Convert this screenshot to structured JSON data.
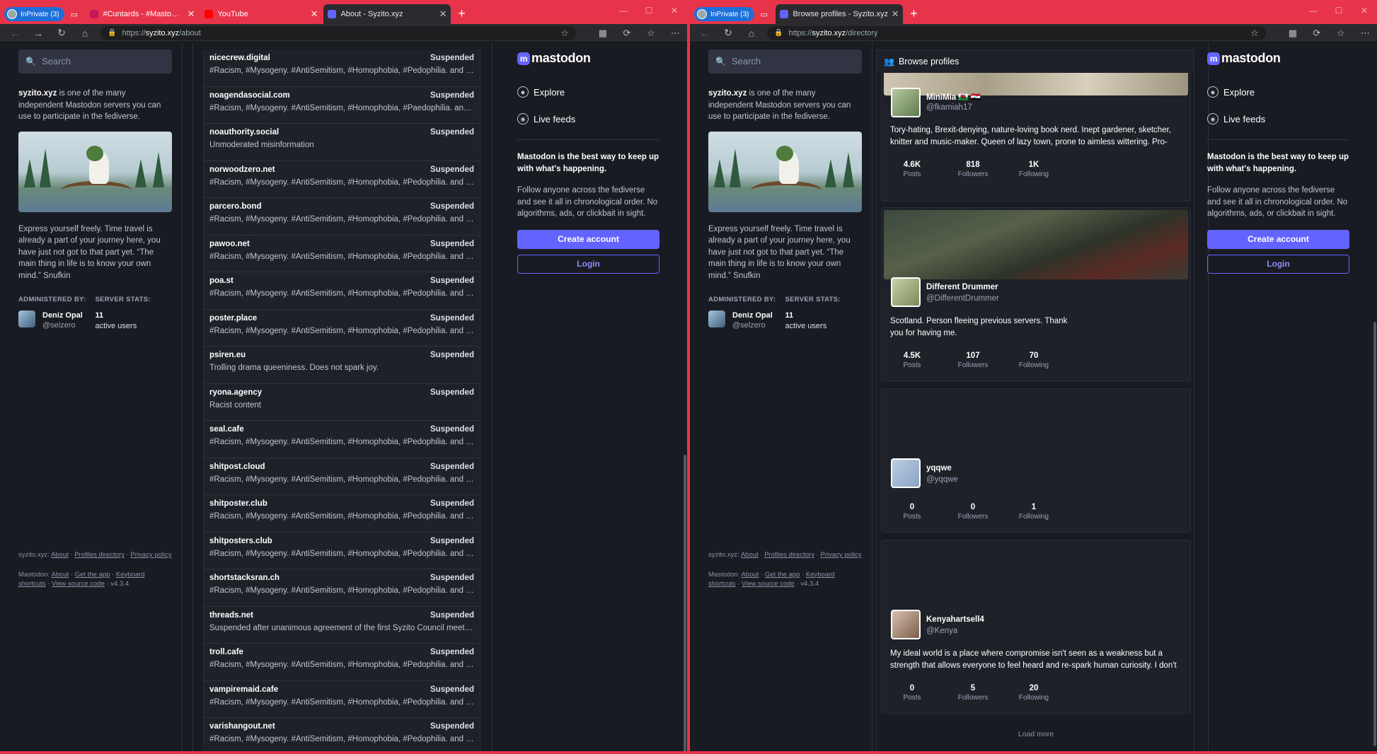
{
  "left_window": {
    "tabs": [
      {
        "label": "InPrivate (3)"
      },
      {
        "label": ""
      },
      {
        "label": "#Cuntards - #MastodonSpyBallo..."
      },
      {
        "label": "YouTube"
      },
      {
        "label": "About - Syzito.xyz"
      }
    ],
    "url_prefix": "https://",
    "url_host": "syzito.xyz",
    "url_path": "/about",
    "search_placeholder": "Search",
    "blocked": [
      {
        "domain": "nicecrew.digital",
        "status": "Suspended",
        "reason": "#Racism, #Mysogeny. #AntiSemitism, #Homophobia, #Pedophilia. and #..."
      },
      {
        "domain": "noagendasocial.com",
        "status": "Suspended",
        "reason": "#Racism, #Mysogeny. #AntiSemitism, #Homophobia, #Paedophilia. and ..."
      },
      {
        "domain": "noauthority.social",
        "status": "Suspended",
        "reason": "Unmoderated misinformation"
      },
      {
        "domain": "norwoodzero.net",
        "status": "Suspended",
        "reason": "#Racism, #Mysogeny. #AntiSemitism, #Homophobia, #Pedophilia. and #..."
      },
      {
        "domain": "parcero.bond",
        "status": "Suspended",
        "reason": "#Racism, #Mysogeny. #AntiSemitism, #Homophobia, #Pedophilia. and #..."
      },
      {
        "domain": "pawoo.net",
        "status": "Suspended",
        "reason": "#Racism, #Mysogeny. #AntiSemitism, #Homophobia, #Pedophilia. and #..."
      },
      {
        "domain": "poa.st",
        "status": "Suspended",
        "reason": "#Racism, #Mysogeny. #AntiSemitism, #Homophobia, #Pedophilia. and #..."
      },
      {
        "domain": "poster.place",
        "status": "Suspended",
        "reason": "#Racism, #Mysogeny. #AntiSemitism, #Homophobia, #Pedophilia. and #..."
      },
      {
        "domain": "psiren.eu",
        "status": "Suspended",
        "reason": "Trolling drama queeniness. Does not spark joy."
      },
      {
        "domain": "ryona.agency",
        "status": "Suspended",
        "reason": "Racist content"
      },
      {
        "domain": "seal.cafe",
        "status": "Suspended",
        "reason": "#Racism, #Mysogeny. #AntiSemitism, #Homophobia, #Pedophilia. and #..."
      },
      {
        "domain": "shitpost.cloud",
        "status": "Suspended",
        "reason": "#Racism, #Mysogeny. #AntiSemitism, #Homophobia, #Pedophilia. and #..."
      },
      {
        "domain": "shitposter.club",
        "status": "Suspended",
        "reason": "#Racism, #Mysogeny. #AntiSemitism, #Homophobia, #Pedophilia. and #..."
      },
      {
        "domain": "shitposters.club",
        "status": "Suspended",
        "reason": "#Racism, #Mysogeny. #AntiSemitism, #Homophobia, #Pedophilia. and #..."
      },
      {
        "domain": "shortstacksran.ch",
        "status": "Suspended",
        "reason": "#Racism, #Mysogeny. #AntiSemitism, #Homophobia, #Pedophilia. and #..."
      },
      {
        "domain": "threads.net",
        "status": "Suspended",
        "reason": "Suspended after unanimous agreement of the first Syzito Council meetin..."
      },
      {
        "domain": "troll.cafe",
        "status": "Suspended",
        "reason": "#Racism, #Mysogeny. #AntiSemitism, #Homophobia, #Pedophilia. and #..."
      },
      {
        "domain": "vampiremaid.cafe",
        "status": "Suspended",
        "reason": "#Racism, #Mysogeny. #AntiSemitism, #Homophobia, #Pedophilia. and #..."
      },
      {
        "domain": "varishangout.net",
        "status": "Suspended",
        "reason": "#Racism, #Mysogeny. #AntiSemitism, #Homophobia, #Pedophilia. and #..."
      }
    ]
  },
  "right_window": {
    "tabs": [
      {
        "label": "InPrivate (3)"
      },
      {
        "label": ""
      },
      {
        "label": "Browse profiles - Syzito.xyz"
      }
    ],
    "url_prefix": "https://",
    "url_host": "syzito.xyz",
    "url_path": "/directory",
    "search_placeholder": "Search",
    "directory_title": "Browse profiles",
    "profiles": [
      {
        "display_name": "MiniMia 🏴󠁧󠁢󠁷󠁬󠁳󠁿 🇮🇶",
        "handle": "@fkamiah17",
        "bio": "Tory-hating, Brexit-denying, nature-loving book nerd. Inept gardener, sketcher, knitter and music-maker. Queen of lazy town, prone to aimless wittering. Pro-",
        "posts": "4.6K",
        "followers": "818",
        "following": "1K"
      },
      {
        "display_name": "Different Drummer",
        "handle": "@DifferentDrummer",
        "bio": "Scotland. Person fleeing previous servers. Thank you for having me.",
        "posts": "4.5K",
        "followers": "107",
        "following": "70"
      },
      {
        "display_name": "yqqwe",
        "handle": "@yqqwe",
        "bio": "",
        "posts": "0",
        "followers": "0",
        "following": "1"
      },
      {
        "display_name": "Kenyahartsell4",
        "handle": "@Kenya",
        "bio": "My ideal world is a place where compromise isn't seen as a weakness but a strength that allows everyone to feel heard and re-spark human curiosity. I don't",
        "posts": "0",
        "followers": "5",
        "following": "20"
      }
    ],
    "stat_labels": {
      "posts": "Posts",
      "followers": "Followers",
      "following": "Following"
    },
    "load_more": "Load more"
  },
  "about": {
    "server": "syzito.xyz",
    "intro_rest": " is one of the many independent Mastodon servers you can use to participate in the fediverse.",
    "description": "Express yourself freely. Time travel is already a part of your journey here, you have just not got to that part yet. “The main thing in life is to know your own mind.” Snufkin",
    "administered_by_label": "Administered by:",
    "server_stats_label": "Server stats:",
    "admin_name": "Deniz Opal",
    "admin_handle": "@selzero",
    "active_users": "11",
    "active_users_label": "active users"
  },
  "footer": {
    "line1_prefix": "syzito.xyz:",
    "about": "About",
    "profiles_directory": "Profiles directory",
    "privacy_policy": "Privacy policy",
    "line2_prefix": "Mastodon:",
    "get_the_app": "Get the app",
    "keyboard_shortcuts": "Keyboard shortcuts",
    "view_source_code": "View source code",
    "version": "v4.3.4"
  },
  "navigation": {
    "logo": "mastodon",
    "explore": "Explore",
    "live_feeds": "Live feeds",
    "promo_title": "Mastodon is the best way to keep up with what's happening.",
    "promo_body": "Follow anyone across the fediverse and see it all in chronological order. No algorithms, ads, or clickbait in sight.",
    "create_account": "Create account",
    "login": "Login"
  },
  "colors": {
    "brand": "#6364ff",
    "browser_frame": "#e8344a",
    "background": "#191b22",
    "inprivate": "#1d6fd8"
  }
}
